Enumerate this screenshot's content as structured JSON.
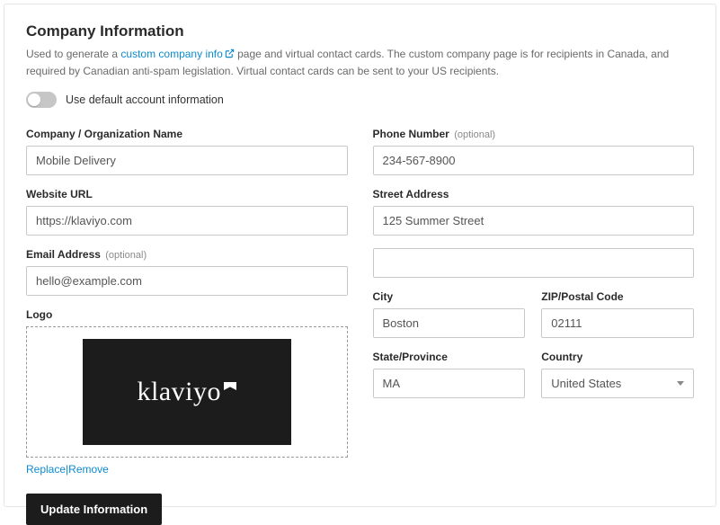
{
  "title": "Company Information",
  "description_pre": "Used to generate a ",
  "description_link": "custom company info",
  "description_post": " page and virtual contact cards. The custom company page is for recipients in Canada, and required by Canadian anti-spam legislation. Virtual contact cards can be sent to your US recipients.",
  "toggle_label": "Use default account information",
  "labels": {
    "company": "Company / Organization Name",
    "website": "Website URL",
    "email": "Email Address",
    "logo": "Logo",
    "phone": "Phone Number",
    "street": "Street Address",
    "city": "City",
    "zip": "ZIP/Postal Code",
    "state": "State/Province",
    "country": "Country",
    "optional": "(optional)"
  },
  "values": {
    "company": "Mobile Delivery",
    "website": "https://klaviyo.com",
    "email": "hello@example.com",
    "phone": "234-567-8900",
    "street": "125 Summer Street",
    "street2": "",
    "city": "Boston",
    "zip": "02111",
    "state": "MA",
    "country": "United States"
  },
  "logo": {
    "brand_text": "klaviyo",
    "replace": "Replace",
    "remove": "Remove"
  },
  "submit": "Update Information"
}
